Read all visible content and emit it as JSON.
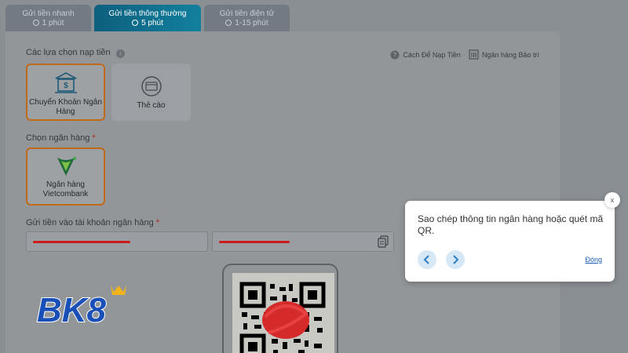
{
  "tabs": [
    {
      "title": "Gửi tiền nhanh",
      "time": "1 phút"
    },
    {
      "title": "Gửi tiền thông thường",
      "time": "5 phút"
    },
    {
      "title": "Gửi tiền điện tử",
      "time": "1-15 phút"
    }
  ],
  "deposit_options_label": "Các lựa chọn nạp tiền",
  "links": {
    "how_to": "Cách Để Nạp Tiền",
    "maintenance": "Ngân hàng Bảo trì"
  },
  "options": [
    {
      "label": "Chuyển Khoản Ngân Hàng",
      "selected": true
    },
    {
      "label": "Thẻ cào",
      "selected": false
    }
  ],
  "bank_label": "Chọn ngân hàng",
  "bank": {
    "name": "Ngân hàng Vietcombank"
  },
  "account_label": "Gửi tiền vào tài khoản ngân hàng",
  "logo_text": "BK8",
  "popup": {
    "text": "Sao chép thông tin ngân hàng hoặc quét mã QR.",
    "close": "x",
    "done": "Đóng"
  },
  "colors": {
    "accent": "#c06a18",
    "active_tab": "#12809d",
    "link": "#1d5fb5",
    "required": "#b3261e"
  }
}
